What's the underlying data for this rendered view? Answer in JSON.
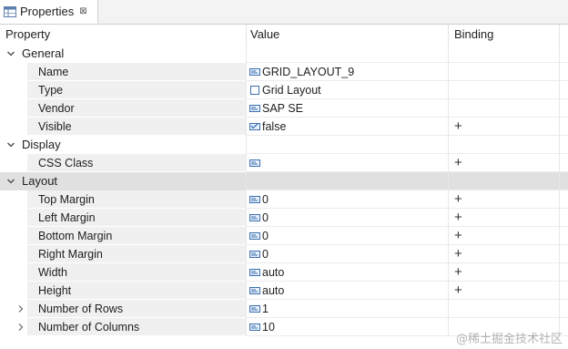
{
  "tab": {
    "label": "Properties",
    "close": "⊠"
  },
  "columns": {
    "property": "Property",
    "value": "Value",
    "binding": "Binding"
  },
  "categories": {
    "general": "General",
    "display": "Display",
    "layout": "Layout"
  },
  "rows": {
    "name": {
      "label": "Name",
      "value": "GRID_LAYOUT_9",
      "icon": "text-field-icon",
      "binding": ""
    },
    "type": {
      "label": "Type",
      "value": "Grid Layout",
      "icon": "checkbox-icon",
      "binding": ""
    },
    "vendor": {
      "label": "Vendor",
      "value": "SAP SE",
      "icon": "text-field-icon",
      "binding": ""
    },
    "visible": {
      "label": "Visible",
      "value": "false",
      "icon": "boolean-field-icon",
      "binding": "+"
    },
    "css_class": {
      "label": "CSS Class",
      "value": "",
      "icon": "text-field-icon",
      "binding": "+"
    },
    "top_margin": {
      "label": "Top Margin",
      "value": "0",
      "icon": "text-field-icon",
      "binding": "+"
    },
    "left_margin": {
      "label": "Left Margin",
      "value": "0",
      "icon": "text-field-icon",
      "binding": "+"
    },
    "bottom_margin": {
      "label": "Bottom Margin",
      "value": "0",
      "icon": "text-field-icon",
      "binding": "+"
    },
    "right_margin": {
      "label": "Right Margin",
      "value": "0",
      "icon": "text-field-icon",
      "binding": "+"
    },
    "width": {
      "label": "Width",
      "value": "auto",
      "icon": "text-field-icon",
      "binding": "+"
    },
    "height": {
      "label": "Height",
      "value": "auto",
      "icon": "text-field-icon",
      "binding": "+"
    },
    "num_rows": {
      "label": "Number of Rows",
      "value": "1",
      "icon": "text-field-icon",
      "binding": ""
    },
    "num_cols": {
      "label": "Number of Columns",
      "value": "10",
      "icon": "text-field-icon",
      "binding": ""
    }
  },
  "watermark": "@稀土掘金技术社区",
  "colors": {
    "selected_row": "#e0e0e0",
    "property_cell": "#f0f0f0",
    "icon_blue": "#3a6fb0"
  }
}
